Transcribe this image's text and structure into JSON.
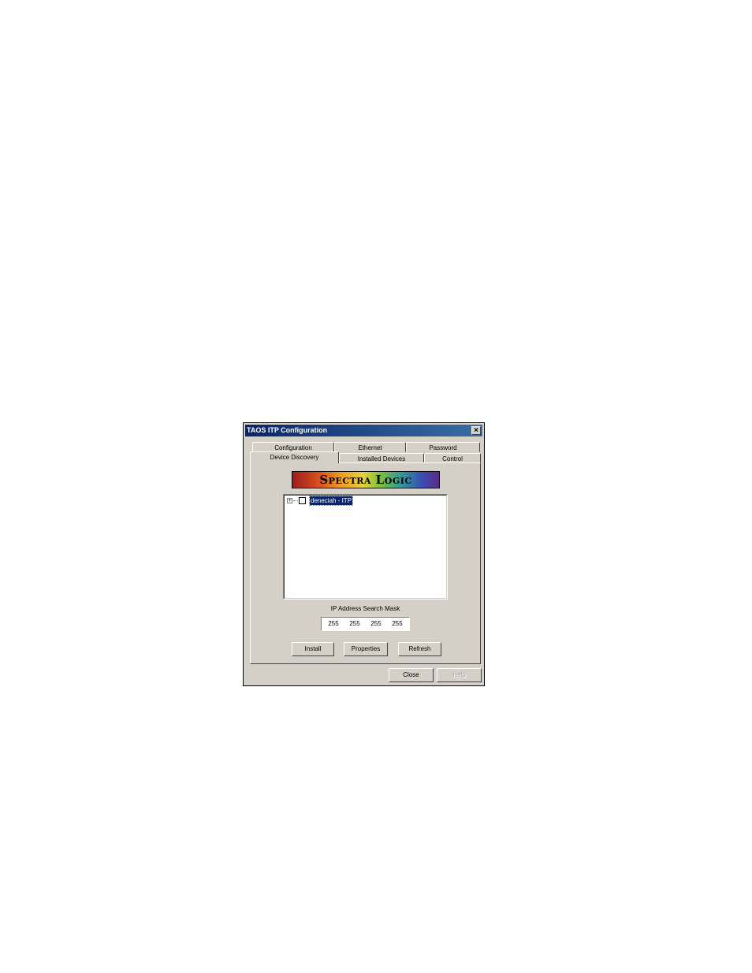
{
  "window": {
    "title": "TAOS ITP Configuration",
    "close_glyph": "×"
  },
  "tabs": {
    "row_back": [
      "Configuration",
      "Ethernet",
      "Password"
    ],
    "row_front": [
      "Device Discovery",
      "Installed Devices",
      "Control"
    ],
    "active": "Device Discovery"
  },
  "logo": {
    "text": "Spectra Logic"
  },
  "tree": {
    "expand_glyph": "+",
    "items": [
      {
        "label": "deneciah - ITP",
        "checked": false,
        "selected": true
      }
    ]
  },
  "mask": {
    "label": "IP Address Search Mask",
    "octets": [
      "255",
      "255",
      "255",
      "255"
    ]
  },
  "buttons": {
    "install": "Install",
    "properties": "Properties",
    "refresh": "Refresh",
    "close": "Close",
    "help": "Help"
  },
  "icons": {
    "close": "close-icon",
    "expand": "plus-expand-icon",
    "checkbox": "checkbox-icon"
  }
}
